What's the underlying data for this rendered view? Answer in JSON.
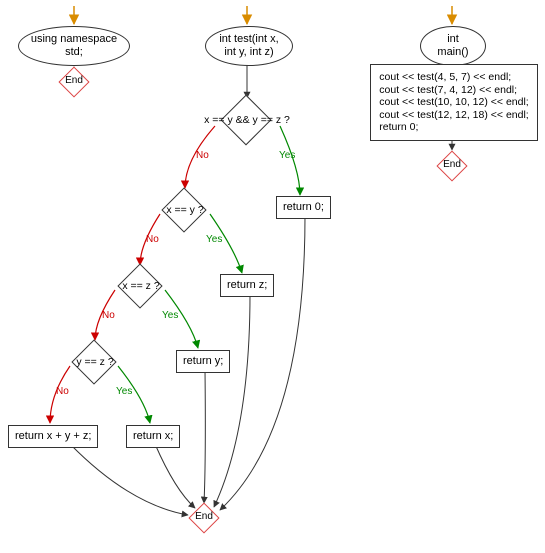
{
  "column1": {
    "start": "using namespace std;",
    "end": "End"
  },
  "column2": {
    "start": "int test(int x,\nint y, int z)",
    "d1": "x == y && y == z ?",
    "d2": "x == y ?",
    "d3": "x == z ?",
    "d4": "y == z ?",
    "r0": "return 0;",
    "rz": "return z;",
    "ry": "return y;",
    "rx": "return x;",
    "rsum": "return x + y + z;",
    "end": "End"
  },
  "column3": {
    "start": "int main()",
    "body": "cout << test(4, 5, 7) << endl;\ncout << test(7, 4, 12) << endl;\ncout << test(10, 10, 12) << endl;\ncout << test(12, 12, 18) << endl;\nreturn 0;",
    "end": "End"
  },
  "labels": {
    "no": "No",
    "yes": "Yes"
  }
}
